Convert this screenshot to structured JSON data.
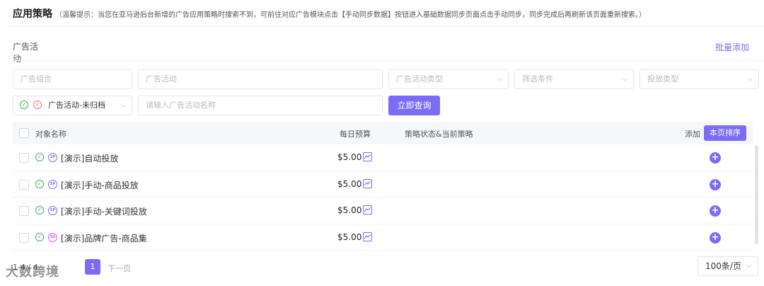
{
  "header": {
    "title": "应用策略",
    "tip": "（温馨提示：当您在亚马逊后台新增的广告应用策略时搜索不到，可前往对应广告模块点击【手动同步数据】按钮进入基础数据同步页面点击手动同步，同步完成后再刷新该页面重新搜索。）"
  },
  "tabs": [
    {
      "label": "广告活动",
      "active": true
    }
  ],
  "toolbar": {
    "batch_add_label": "批量添加",
    "query_label": "立即查询"
  },
  "filters": {
    "ad_group_placeholder": "广告组合",
    "campaign_placeholder": "广告活动",
    "campaign_type_placeholder": "广告活动类型",
    "filter_condition_placeholder": "筛选条件",
    "delivery_type_placeholder": "投放类型",
    "status_select_value": "广告活动-未归档",
    "search_placeholder": "请输入广告活动名称"
  },
  "table": {
    "columns": {
      "name": "对象名称",
      "budget": "每日预算",
      "status": "策略状态&当前策略",
      "add": "添加",
      "sort_button": "本页排序"
    },
    "rows": [
      {
        "type": "SP",
        "name": "[演示]自动投放",
        "budget": "$5.00"
      },
      {
        "type": "SP",
        "name": "[演示]手动-商品投放",
        "budget": "$5.00"
      },
      {
        "type": "SP",
        "name": "[演示]手动-关键词投放",
        "budget": "$5.00"
      },
      {
        "type": "SD",
        "name": "[演示]品牌广告-商品集",
        "budget": "$5.00"
      }
    ]
  },
  "pager": {
    "info": "1-4 / 4",
    "current_page": "1",
    "next_label": "下一页",
    "page_size": "100条/页"
  },
  "watermark": "大数跨境",
  "colors": {
    "accent": "#7b6cf6",
    "ok": "#3fb45a",
    "paused": "#e87777",
    "sd_badge": "#d45bd6"
  }
}
